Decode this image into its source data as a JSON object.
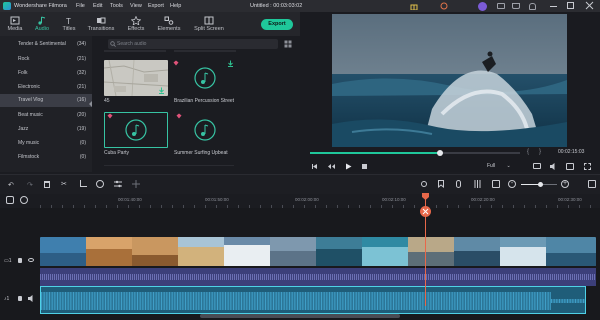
{
  "app": {
    "name": "Wondershare Filmora",
    "menu": [
      "File",
      "Edit",
      "Tools",
      "View",
      "Export",
      "Help"
    ],
    "project_title": "Untitled : 00:03:03:02"
  },
  "toolbar": {
    "tabs": [
      {
        "label": "Media",
        "icon": "media-icon"
      },
      {
        "label": "Audio",
        "icon": "music-note-icon"
      },
      {
        "label": "Titles",
        "icon": "text-icon"
      },
      {
        "label": "Transitions",
        "icon": "transition-icon"
      },
      {
        "label": "Effects",
        "icon": "effects-icon"
      },
      {
        "label": "Elements",
        "icon": "elements-icon"
      },
      {
        "label": "Split Screen",
        "icon": "split-screen-icon"
      }
    ],
    "active_tab": "Audio",
    "export_label": "Export"
  },
  "categories": [
    {
      "name": "Tender & Sentimental",
      "count": "(34)"
    },
    {
      "name": "Rock",
      "count": "(21)"
    },
    {
      "name": "Folk",
      "count": "(32)"
    },
    {
      "name": "Electronic",
      "count": "(21)"
    },
    {
      "name": "Travel Vlog",
      "count": "(16)"
    },
    {
      "name": "Beat music",
      "count": "(20)"
    },
    {
      "name": "Jazz",
      "count": "(19)"
    },
    {
      "name": "My music",
      "count": "(0)"
    },
    {
      "name": "Filmstock",
      "count": "(0)"
    }
  ],
  "active_category": "Travel Vlog",
  "library": {
    "search_placeholder": "Search audio",
    "items": [
      {
        "label": "45"
      },
      {
        "label": "Brazilian Percussion Street"
      },
      {
        "label": "Cuba Party"
      },
      {
        "label": "Summer Surfing Upbeat"
      }
    ]
  },
  "preview": {
    "timecode": "00:02:15:03",
    "quality": "Full",
    "progress": 0.62
  },
  "timeline": {
    "ruler_labels": [
      "00:01:40:00",
      "00:01:50:00",
      "00:02:00:00",
      "00:02:10:00",
      "00:02:20:00",
      "00:02:30:00"
    ]
  },
  "colors": {
    "accent": "#1fc79a",
    "playhead": "#e8684a",
    "audio_wave": "#3f9ec7"
  }
}
